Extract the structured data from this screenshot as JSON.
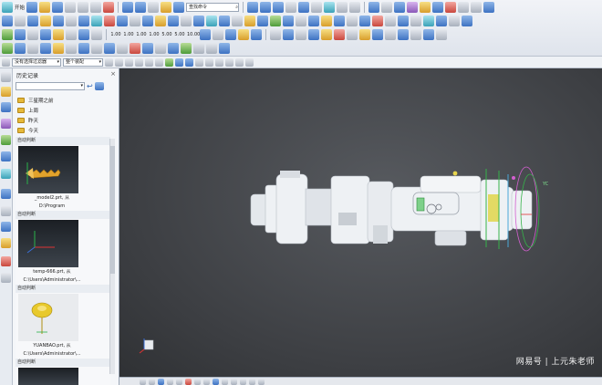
{
  "toolbar": {
    "start_label": "开始",
    "command_search": "查找命令",
    "search_placeholder": "",
    "numeric_buttons": [
      "1.00",
      "1.00",
      "1.00",
      "1.00",
      "5.00",
      "5.00",
      "10.00"
    ],
    "numeric_sub": [
      "",
      "",
      "",
      "",
      "",
      "",
      ""
    ]
  },
  "filterbar": {
    "selection_filter": "没有选择过滤器",
    "assembly_scope": "整个装配"
  },
  "history_panel": {
    "title": "历史记录",
    "folders": [
      "三星期之前",
      "上周",
      "昨天",
      "今天"
    ],
    "items": [
      {
        "label": "自动判断",
        "caption_line1": "_model2.prt, 从",
        "caption_line2": "D:\\Program"
      },
      {
        "label": "自动判断",
        "caption_line1": "temp-666.prt, 从",
        "caption_line2": "C:\\Users\\Administrator\\..."
      },
      {
        "label": "自动判断",
        "caption_line1": "YUANBAO.prt, 从",
        "caption_line2": "C:\\Users\\Administrator\\..."
      },
      {
        "label": "自动判断",
        "caption_line1": "",
        "caption_line2": ""
      }
    ]
  },
  "viewport": {
    "axis_label_y": "YC"
  },
  "watermark": "网易号 | 上元朱老师",
  "colors": {
    "viewport_bg": "#3c3e42",
    "part_body": "#e8ecf0",
    "accent_yellow": "#e1d64a",
    "accent_green": "#36b34a"
  }
}
